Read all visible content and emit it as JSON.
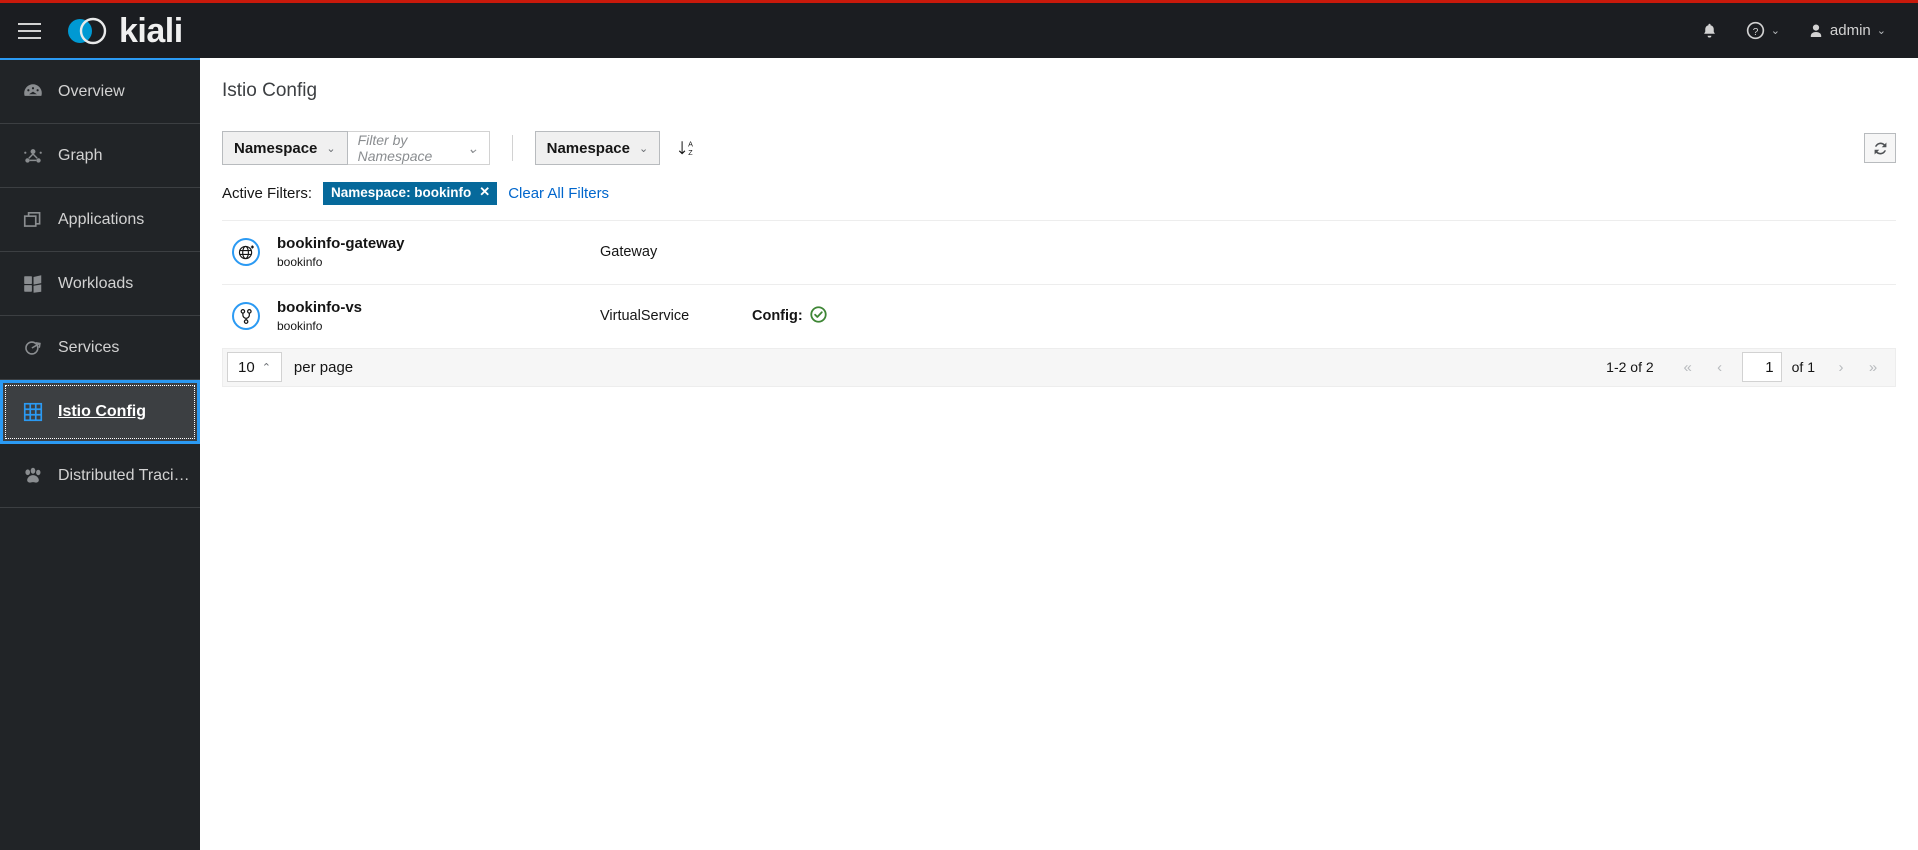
{
  "theme": {
    "accent_red": "#c9190b",
    "brand_blue": "#2b9af3",
    "link_blue": "#0066cc",
    "chip_blue": "#06699b",
    "ok_green": "#3e8635",
    "masthead_bg": "#1b1d21",
    "sidebar_bg": "#212427"
  },
  "masthead": {
    "menu_icon": "hamburger-icon",
    "brand_name": "kiali",
    "notifications_icon": "bell-icon",
    "help_icon": "question-circle-icon",
    "help_caret": "⌄",
    "user_icon": "user-icon",
    "user_name": "admin",
    "user_caret": "⌄"
  },
  "sidebar": {
    "items": [
      {
        "label": "Overview",
        "icon": "dashboard-icon",
        "active": false
      },
      {
        "label": "Graph",
        "icon": "topology-icon",
        "active": false
      },
      {
        "label": "Applications",
        "icon": "applications-icon",
        "active": false
      },
      {
        "label": "Workloads",
        "icon": "cubes-icon",
        "active": false
      },
      {
        "label": "Services",
        "icon": "service-arrow-icon",
        "active": false
      },
      {
        "label": "Istio Config",
        "icon": "grid-config-icon",
        "active": true
      },
      {
        "label": "Distributed Traci…",
        "icon": "paw-icon",
        "active": false
      }
    ]
  },
  "page": {
    "title": "Istio Config"
  },
  "toolbar": {
    "filter_category_label": "Namespace",
    "filter_category_caret": "⌄",
    "filter_input_placeholder": "Filter by Namespace",
    "filter_input_value": "",
    "filter_input_caret": "⌄",
    "sort_select_label": "Namespace",
    "sort_select_caret": "⌄",
    "sort_icon": "sort-alpha-down-icon",
    "refresh_icon": "sync-icon"
  },
  "active_filters": {
    "label": "Active Filters:",
    "chips": [
      {
        "text": "Namespace: bookinfo",
        "remove_icon": "✕"
      }
    ],
    "clear_all_label": "Clear All Filters"
  },
  "list": {
    "rows": [
      {
        "icon": "gateway-globe-icon",
        "name": "bookinfo-gateway",
        "namespace": "bookinfo",
        "type": "Gateway",
        "config_label": "",
        "config_status": ""
      },
      {
        "icon": "virtualservice-branch-icon",
        "name": "bookinfo-vs",
        "namespace": "bookinfo",
        "type": "VirtualService",
        "config_label": "Config:",
        "config_status": "valid"
      }
    ]
  },
  "pagination": {
    "per_page_value": "10",
    "per_page_caret": "⌃",
    "per_page_label": "per page",
    "range_label": "1-2 of 2",
    "first_icon": "«",
    "prev_icon": "‹",
    "page_value": "1",
    "of_label": "of 1",
    "next_icon": "›",
    "last_icon": "»"
  }
}
